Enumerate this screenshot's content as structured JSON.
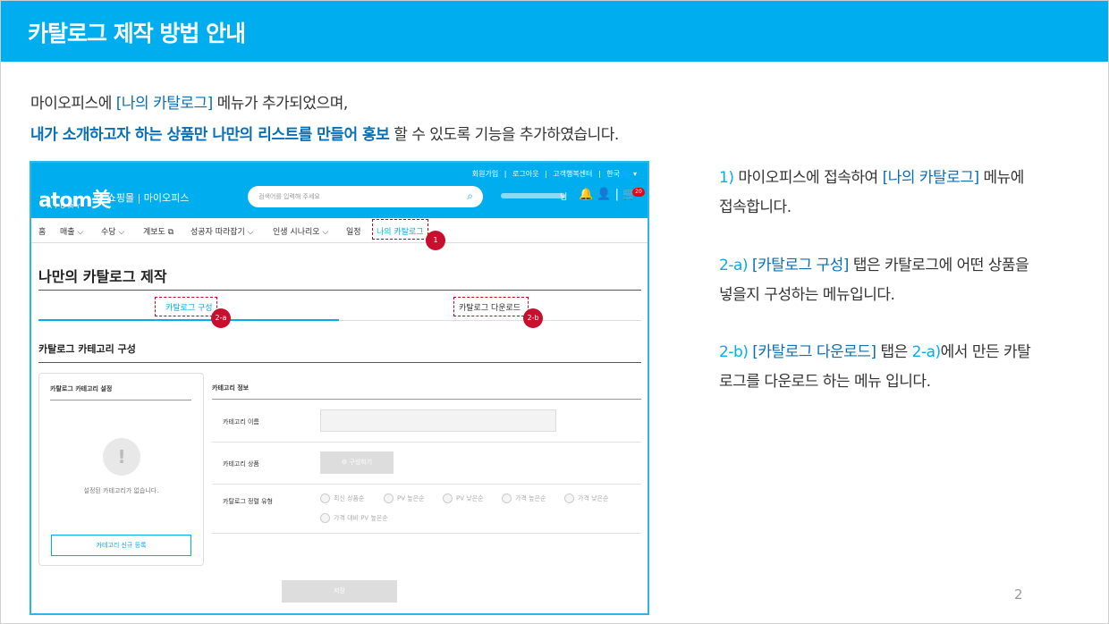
{
  "header": {
    "title": "카탈로그 제작 방법 안내",
    "bg_color": "#00aeef"
  },
  "intro": {
    "line1_a": "마이오피스에 ",
    "line1_hl": "[나의 카탈로그]",
    "line1_b": " 메뉴가 추가되었으며,",
    "line2_hl": "내가 소개하고자 하는 상품만 나만의 리스트를 만들어 홍보",
    "line2_b": " 할 수 있도록 기능을 추가하였습니다."
  },
  "shot": {
    "toplinks": [
      "회원가입",
      "|",
      "로그아웃",
      "|",
      "고객행복센터",
      "|",
      "한국 🌐 ▾"
    ],
    "logo": "atom美",
    "logo_sub": "ATOMY",
    "shop_links": "⊙ 쇼핑몰  |  마이오피스",
    "search_placeholder": "검색어를 입력해 주세요",
    "user_suffix": "님",
    "icons": "🔔  👤  |  🛒",
    "cart_count": "20",
    "nav": [
      "홈",
      "매출 ⌵",
      "수당 ⌵",
      "계보도 ⧉",
      "성공자 따라잡기 ⌵",
      "인생 시나리오 ⌵",
      "일정",
      "나의 카탈로그"
    ],
    "page_title": "나만의 카탈로그 제작",
    "tab_a": "카탈로그 구성",
    "tab_b": "카탈로그 다운로드",
    "section_title": "카탈로그 카테고리 구성",
    "left_panel": {
      "title": "카탈로그 카테고리 설정",
      "empty_icon": "!",
      "empty_text": "설정된 카테고리가 없습니다.",
      "button": "카테고리 신규 등록"
    },
    "right_panel": {
      "title": "카테고리 정보",
      "name_label": "카테고리 이름",
      "product_label": "카테고리 상품",
      "config_button": "⚙ 구성하기",
      "sort_label": "카탈로그 정렬 유형",
      "sort_options": [
        "최신 상품순",
        "PV 높은순",
        "PV 낮은순",
        "가격 높은순",
        "가격 낮은순",
        "가격 대비 PV 높은순"
      ]
    },
    "save_button": "저장",
    "markers": [
      "1",
      "2-a",
      "2-b"
    ]
  },
  "steps": [
    {
      "num": "1)",
      "a": " 마이오피스에 접속하여 ",
      "hl": "[나의 카탈로그]",
      "b": " 메뉴에",
      "line2": "접속합니다."
    },
    {
      "num": "2-a)",
      "a": " ",
      "hl": "[카탈로그 구성]",
      "b": " 탭은 카탈로그에 어떤 상품을",
      "line2": "넣을지 구성하는 메뉴입니다."
    },
    {
      "num": "2-b)",
      "a": " ",
      "hl": "[카탈로그 다운로드]",
      "b": " 탭은 ",
      "num2": "2-a)",
      "c": "에서 만든 카탈",
      "line2": "로그를 다운로드 하는 메뉴 입니다."
    }
  ],
  "page_number": "2"
}
